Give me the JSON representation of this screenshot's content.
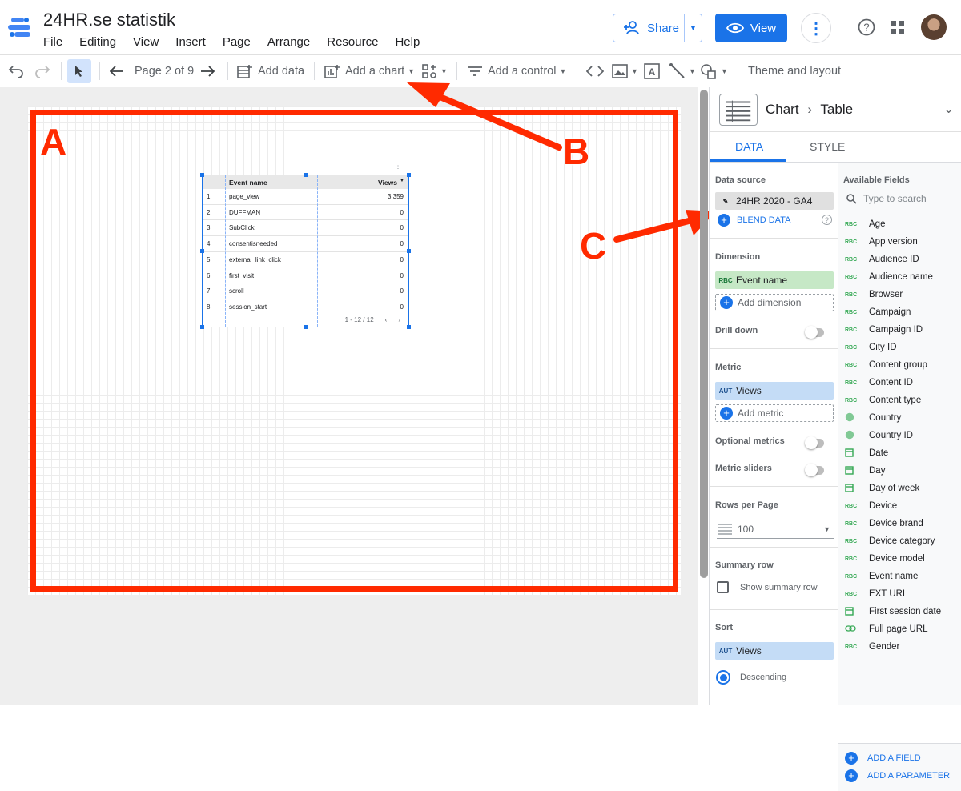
{
  "header": {
    "title": "24HR.se statistik",
    "menu": [
      "File",
      "Editing",
      "View",
      "Insert",
      "Page",
      "Arrange",
      "Resource",
      "Help"
    ],
    "share_label": "Share",
    "view_label": "View"
  },
  "toolbar": {
    "page_label": "Page 2 of 9",
    "add_data": "Add data",
    "add_chart": "Add a chart",
    "add_control": "Add a control",
    "theme_layout": "Theme and layout"
  },
  "annotations": {
    "a": "A",
    "b": "B",
    "c": "C",
    "color": "#ff2a00"
  },
  "table_chart": {
    "headers": {
      "name": "Event name",
      "value": "Views"
    },
    "rows": [
      {
        "num": "1.",
        "name": "page_view",
        "value": "3,359"
      },
      {
        "num": "2.",
        "name": "DUFFMAN",
        "value": "0"
      },
      {
        "num": "3.",
        "name": "SubClick",
        "value": "0"
      },
      {
        "num": "4.",
        "name": "consentisneeded",
        "value": "0"
      },
      {
        "num": "5.",
        "name": "external_link_click",
        "value": "0"
      },
      {
        "num": "6.",
        "name": "first_visit",
        "value": "0"
      },
      {
        "num": "7.",
        "name": "scroll",
        "value": "0"
      },
      {
        "num": "8.",
        "name": "session_start",
        "value": "0"
      }
    ],
    "pager": "1 - 12 / 12"
  },
  "panel": {
    "breadcrumb_chart": "Chart",
    "breadcrumb_type": "Table",
    "tab_data": "DATA",
    "tab_style": "STYLE",
    "data_source_label": "Data source",
    "data_source": "24HR 2020 - GA4",
    "blend_data": "BLEND DATA",
    "dimension_label": "Dimension",
    "dimension_tag": "RBC",
    "dimension": "Event name",
    "add_dimension": "Add dimension",
    "drill_down": "Drill down",
    "metric_label": "Metric",
    "metric_tag": "AUT",
    "metric": "Views",
    "add_metric": "Add metric",
    "optional_metrics": "Optional metrics",
    "metric_sliders": "Metric sliders",
    "rows_per_page_label": "Rows per Page",
    "rows_per_page": "100",
    "summary_row_label": "Summary row",
    "show_summary_row": "Show summary row",
    "sort_label": "Sort",
    "sort_tag": "AUT",
    "sort_field": "Views",
    "descending": "Descending"
  },
  "fields": {
    "title": "Available Fields",
    "search_placeholder": "Type to search",
    "items": [
      {
        "type": "RBC",
        "name": "Age"
      },
      {
        "type": "RBC",
        "name": "App version"
      },
      {
        "type": "RBC",
        "name": "Audience ID"
      },
      {
        "type": "RBC",
        "name": "Audience name"
      },
      {
        "type": "RBC",
        "name": "Browser"
      },
      {
        "type": "RBC",
        "name": "Campaign"
      },
      {
        "type": "RBC",
        "name": "Campaign ID"
      },
      {
        "type": "RBC",
        "name": "City ID"
      },
      {
        "type": "RBC",
        "name": "Content group"
      },
      {
        "type": "RBC",
        "name": "Content ID"
      },
      {
        "type": "RBC",
        "name": "Content type"
      },
      {
        "type": "globe",
        "name": "Country"
      },
      {
        "type": "globe",
        "name": "Country ID"
      },
      {
        "type": "calendar",
        "name": "Date"
      },
      {
        "type": "calendar",
        "name": "Day"
      },
      {
        "type": "calendar",
        "name": "Day of week"
      },
      {
        "type": "RBC",
        "name": "Device"
      },
      {
        "type": "RBC",
        "name": "Device brand"
      },
      {
        "type": "RBC",
        "name": "Device category"
      },
      {
        "type": "RBC",
        "name": "Device model"
      },
      {
        "type": "RBC",
        "name": "Event name"
      },
      {
        "type": "RBC",
        "name": "EXT URL"
      },
      {
        "type": "calendar",
        "name": "First session date"
      },
      {
        "type": "link",
        "name": "Full page URL"
      },
      {
        "type": "RBC",
        "name": "Gender"
      }
    ],
    "add_field": "ADD A FIELD",
    "add_parameter": "ADD A PARAMETER"
  }
}
